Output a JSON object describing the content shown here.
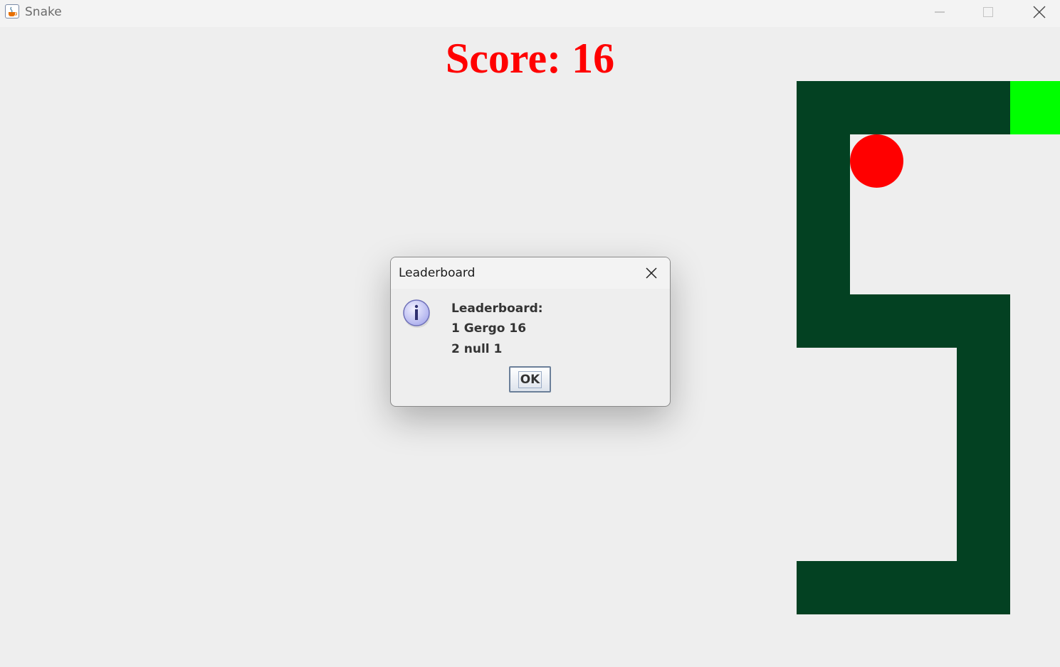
{
  "window": {
    "title": "Snake",
    "app_icon": "java-cup-icon",
    "controls": [
      "minimize-icon",
      "maximize-icon",
      "close-icon"
    ]
  },
  "game": {
    "score_text": "Score: 16",
    "colors": {
      "background": "#eeeeee",
      "snake_body": "#034122",
      "snake_head": "#00ff00",
      "food": "#ff0000",
      "score": "#ff0000"
    }
  },
  "dialog": {
    "title": "Leaderboard",
    "icon": "info-icon",
    "heading": "Leaderboard:",
    "entries": [
      "1 Gergo 16",
      "2 null 1"
    ],
    "ok_label": "OK"
  }
}
